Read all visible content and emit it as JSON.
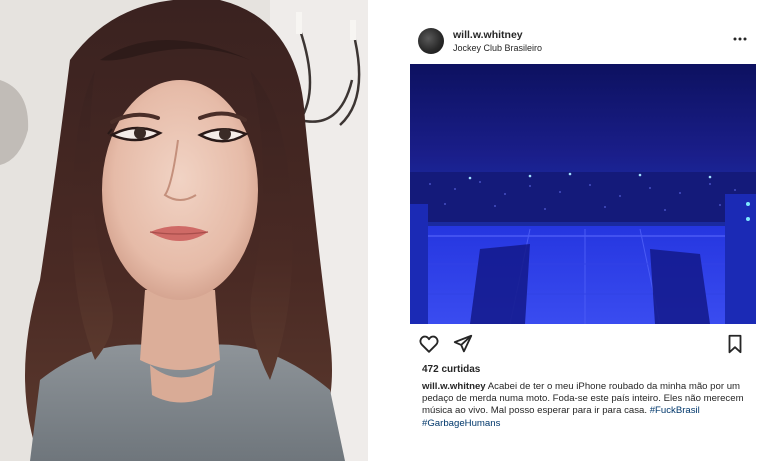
{
  "post": {
    "username": "will.w.whitney",
    "location": "Jockey Club Brasileiro",
    "likes": "472 curtidas",
    "caption": {
      "username": "will.w.whitney",
      "text": "Acabei de ter o meu iPhone roubado da minha mão por um pedaço de merda numa moto. Foda-se este país inteiro. Eles não merecem música ao vivo. Mal posso esperar para ir para casa.",
      "hashtags": [
        "#FuckBrasil",
        "#GarbageHumans"
      ]
    },
    "icons": {
      "avatar": "profile-avatar",
      "more": "more-options-icon",
      "like": "heart-outline-icon",
      "share": "paper-plane-icon",
      "save": "bookmark-icon"
    }
  },
  "colors": {
    "text": "#262626",
    "hashtag": "#00376b",
    "stage_blue": "#1c2bd8",
    "background": "#ffffff"
  }
}
